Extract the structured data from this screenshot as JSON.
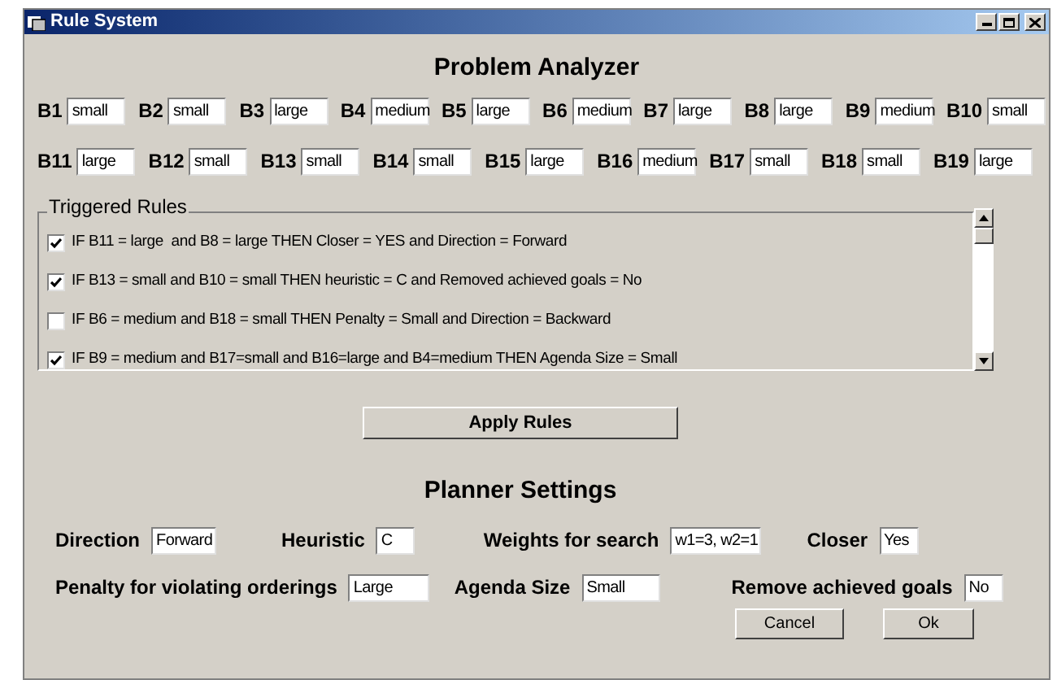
{
  "window": {
    "title": "Rule System"
  },
  "heading": "Problem Analyzer",
  "attribute_rows": [
    [
      {
        "label": "B1",
        "value": "small"
      },
      {
        "label": "B2",
        "value": "small"
      },
      {
        "label": "B3",
        "value": "large"
      },
      {
        "label": "B4",
        "value": "medium"
      },
      {
        "label": "B5",
        "value": "large"
      },
      {
        "label": "B6",
        "value": "medium"
      },
      {
        "label": "B7",
        "value": "large"
      },
      {
        "label": "B8",
        "value": "large"
      },
      {
        "label": "B9",
        "value": "medium"
      },
      {
        "label": "B10",
        "value": "small"
      }
    ],
    [
      {
        "label": "B11",
        "value": "large"
      },
      {
        "label": "B12",
        "value": "small"
      },
      {
        "label": "B13",
        "value": "small"
      },
      {
        "label": "B14",
        "value": "small"
      },
      {
        "label": "B15",
        "value": "large"
      },
      {
        "label": "B16",
        "value": "medium"
      },
      {
        "label": "B17",
        "value": "small"
      },
      {
        "label": "B18",
        "value": "small"
      },
      {
        "label": "B19",
        "value": "large"
      }
    ]
  ],
  "triggered_rules": {
    "title": "Triggered Rules",
    "rules": [
      {
        "text": "IF B11 = large  and B8 = large THEN Closer = YES and Direction = Forward",
        "checked": true
      },
      {
        "text": "IF B13 = small and B10 = small THEN heuristic = C and Removed achieved goals = No",
        "checked": true
      },
      {
        "text": "IF B6 = medium and B18 = small THEN Penalty = Small and Direction = Backward",
        "checked": false
      },
      {
        "text": "IF B9 = medium and B17=small and B16=large and B4=medium THEN Agenda Size = Small",
        "checked": true
      }
    ]
  },
  "apply_button": "Apply Rules",
  "planner": {
    "title": "Planner Settings",
    "fields": [
      {
        "label": "Direction",
        "value": "Forward"
      },
      {
        "label": "Heuristic",
        "value": "C"
      },
      {
        "label": "Weights for search",
        "value": "w1=3, w2=1"
      },
      {
        "label": "Closer",
        "value": "Yes"
      },
      {
        "label": "Penalty for violating orderings",
        "value": "Large"
      },
      {
        "label": "Agenda Size",
        "value": "Small"
      },
      {
        "label": "Remove achieved goals",
        "value": "No"
      }
    ]
  },
  "buttons": [
    "Cancel",
    "Ok"
  ]
}
